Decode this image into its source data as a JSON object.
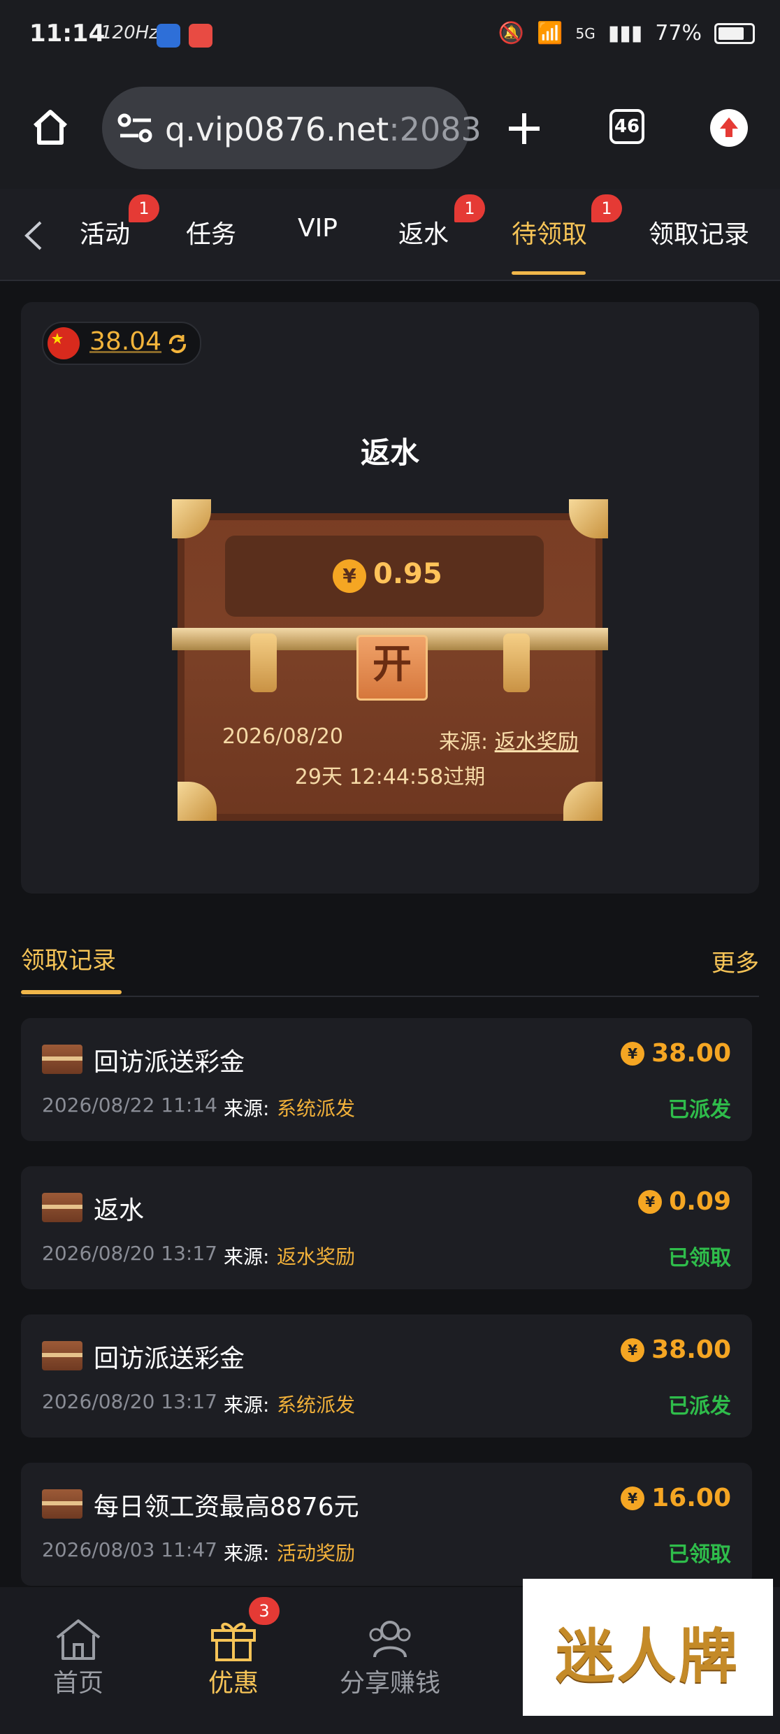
{
  "status_bar": {
    "time": "11:14",
    "refresh": "120Hz",
    "battery": "77%",
    "network": "5G"
  },
  "browser": {
    "url_main": "q.vip0876.net",
    "url_port": ":2083",
    "tab_count": "46"
  },
  "tabs": [
    {
      "label": "活动",
      "badge": "1"
    },
    {
      "label": "任务",
      "badge": ""
    },
    {
      "label": "VIP",
      "badge": ""
    },
    {
      "label": "返水",
      "badge": "1"
    },
    {
      "label": "待领取",
      "badge": "1"
    },
    {
      "label": "领取记录",
      "badge": ""
    }
  ],
  "card": {
    "balance": "38.04",
    "title": "返水",
    "amount": "0.95",
    "lock_label": "开",
    "date": "2026/08/20",
    "source_label": "来源:",
    "source_value": "返水奖励",
    "expiry": "29天 12:44:58过期"
  },
  "records": {
    "header": "领取记录",
    "more": "更多",
    "items": [
      {
        "title": "回访派送彩金",
        "date": "2026/08/22 11:14",
        "source_label": "来源:",
        "source": "系统派发",
        "amount": "38.00",
        "status": "已派发"
      },
      {
        "title": "返水",
        "date": "2026/08/20 13:17",
        "source_label": "来源:",
        "source": "返水奖励",
        "amount": "0.09",
        "status": "已领取"
      },
      {
        "title": "回访派送彩金",
        "date": "2026/08/20 13:17",
        "source_label": "来源:",
        "source": "系统派发",
        "amount": "38.00",
        "status": "已派发"
      },
      {
        "title": "每日领工资最高8876元",
        "date": "2026/08/03 11:47",
        "source_label": "来源:",
        "source": "活动奖励",
        "amount": "16.00",
        "status": "已领取"
      }
    ]
  },
  "bottom_nav": {
    "items": [
      {
        "label": "首页",
        "icon": "home-icon"
      },
      {
        "label": "优惠",
        "icon": "gift-icon",
        "badge": "3"
      },
      {
        "label": "分享赚钱",
        "icon": "share-icon"
      }
    ]
  },
  "watermark": {
    "text": "迷人牌"
  },
  "colors": {
    "accent": "#f6c457",
    "bg": "#121316",
    "card": "#1d1e23",
    "success": "#2fbd4b",
    "badge": "#e53a35"
  }
}
